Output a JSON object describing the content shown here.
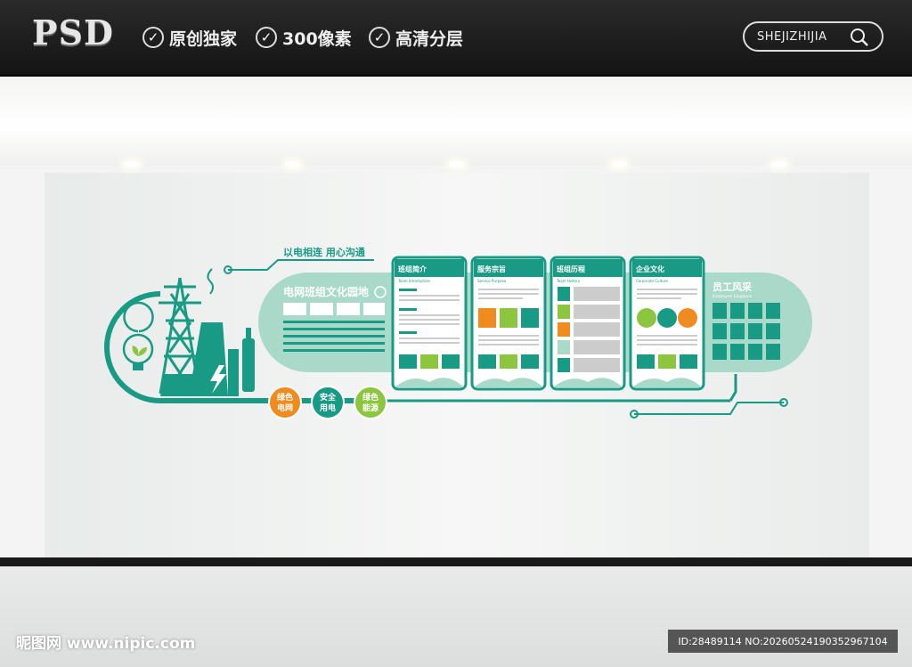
{
  "header": {
    "logo": "PSD",
    "features": [
      "原创独家",
      "300像素",
      "高清分层"
    ],
    "search_label": "SHEJIZHIJIA"
  },
  "wall": {
    "slogan": "以电相连 用心沟通",
    "main_title": "电网班组文化园地",
    "boards": [
      {
        "title": "班组简介",
        "subtitle": "Team Introduction"
      },
      {
        "title": "服务宗旨",
        "subtitle": "Service Purpose"
      },
      {
        "title": "班组历程",
        "subtitle": "Team History"
      },
      {
        "title": "企业文化",
        "subtitle": "Corporate Culture"
      }
    ],
    "staff": {
      "title": "员工风采",
      "subtitle": "Employee Elegance"
    },
    "badges": [
      {
        "text1": "绿色",
        "text2": "电网",
        "color": "#ef8b1f"
      },
      {
        "text1": "安全",
        "text2": "用电",
        "color": "#189a85"
      },
      {
        "text1": "绿色",
        "text2": "能源",
        "color": "#8cc63f"
      }
    ]
  },
  "colors": {
    "teal": "#189a85",
    "mint": "#a9d9c9",
    "orange": "#ef8b1f",
    "green": "#8cc63f"
  },
  "footer": {
    "watermark": "昵图网 www.nipic.com",
    "id_text": "ID:28489114 NO:20260524190352967104"
  }
}
